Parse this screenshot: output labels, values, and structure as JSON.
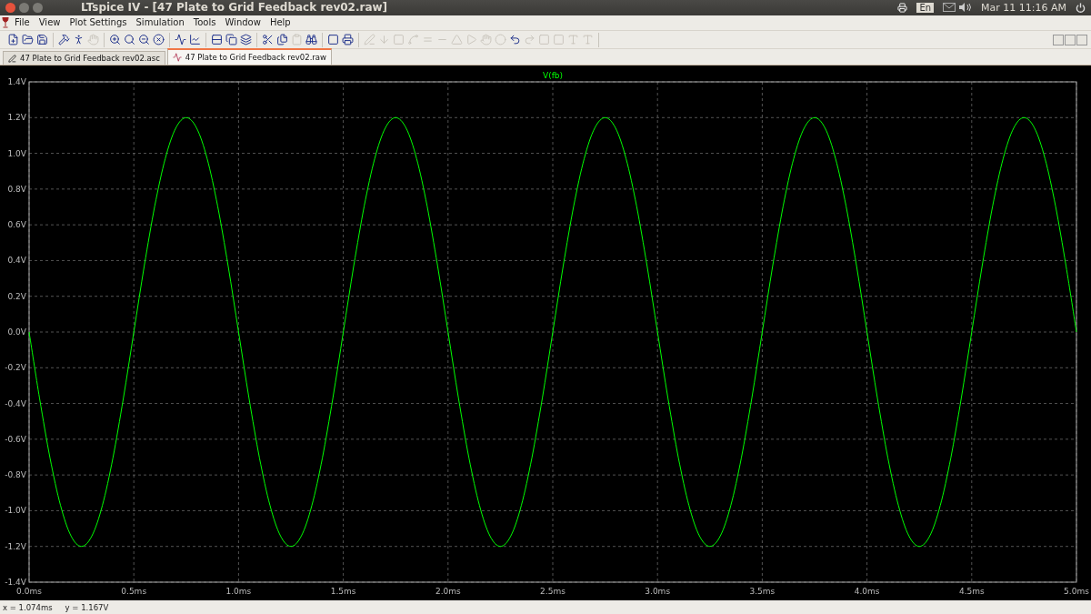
{
  "window": {
    "title": "LTspice IV - [47 Plate to Grid Feedback rev02.raw]"
  },
  "system_tray": {
    "keyboard_layout": "En",
    "clock": "Mar 11 11:16 AM"
  },
  "menu": [
    "File",
    "View",
    "Plot Settings",
    "Simulation",
    "Tools",
    "Window",
    "Help"
  ],
  "tabs": [
    {
      "label": "47 Plate to Grid Feedback rev02.asc",
      "kind": "schematic",
      "selected": false
    },
    {
      "label": "47 Plate to Grid Feedback rev02.raw",
      "kind": "waveform",
      "selected": true
    }
  ],
  "plot": {
    "chart_data": {
      "type": "line",
      "grid": true,
      "xlim": [
        0,
        5
      ],
      "ylim": [
        -1.4,
        1.4
      ],
      "xticks": [
        {
          "value": 0,
          "label": "0.0ms"
        },
        {
          "value": 0.5,
          "label": "0.5ms"
        },
        {
          "value": 1,
          "label": "1.0ms"
        },
        {
          "value": 1.5,
          "label": "1.5ms"
        },
        {
          "value": 2,
          "label": "2.0ms"
        },
        {
          "value": 2.5,
          "label": "2.5ms"
        },
        {
          "value": 3,
          "label": "3.0ms"
        },
        {
          "value": 3.5,
          "label": "3.5ms"
        },
        {
          "value": 4,
          "label": "4.0ms"
        },
        {
          "value": 4.5,
          "label": "4.5ms"
        },
        {
          "value": 5,
          "label": "5.0ms"
        }
      ],
      "yticks": [
        {
          "value": 1.4,
          "label": "1.4V"
        },
        {
          "value": 1.2,
          "label": "1.2V"
        },
        {
          "value": 1,
          "label": "1.0V"
        },
        {
          "value": 0.8,
          "label": "0.8V"
        },
        {
          "value": 0.6,
          "label": "0.6V"
        },
        {
          "value": 0.4,
          "label": "0.4V"
        },
        {
          "value": 0.2,
          "label": "0.2V"
        },
        {
          "value": 0,
          "label": "0.0V"
        },
        {
          "value": -0.2,
          "label": "-0.2V"
        },
        {
          "value": -0.4,
          "label": "-0.4V"
        },
        {
          "value": -0.6,
          "label": "-0.6V"
        },
        {
          "value": -0.8,
          "label": "-0.8V"
        },
        {
          "value": -1,
          "label": "-1.0V"
        },
        {
          "value": -1.2,
          "label": "-1.2V"
        },
        {
          "value": -1.4,
          "label": "-1.4V"
        }
      ],
      "x": [
        0,
        0.05,
        0.1,
        0.15,
        0.2,
        0.25,
        0.3,
        0.35,
        0.4,
        0.45,
        0.5,
        0.55,
        0.6,
        0.65,
        0.7,
        0.75,
        0.8,
        0.85,
        0.9,
        0.95,
        1,
        1.05,
        1.1,
        1.15,
        1.2,
        1.25,
        1.3,
        1.35,
        1.4,
        1.45,
        1.5,
        1.55,
        1.6,
        1.65,
        1.7,
        1.75,
        1.8,
        1.85,
        1.9,
        1.95,
        2,
        2.05,
        2.1,
        2.15,
        2.2,
        2.25,
        2.3,
        2.35,
        2.4,
        2.45,
        2.5,
        2.55,
        2.6,
        2.65,
        2.7,
        2.75,
        2.8,
        2.85,
        2.9,
        2.95,
        3,
        3.05,
        3.1,
        3.15,
        3.2,
        3.25,
        3.3,
        3.35,
        3.4,
        3.45,
        3.5,
        3.55,
        3.6,
        3.65,
        3.7,
        3.75,
        3.8,
        3.85,
        3.9,
        3.95,
        4,
        4.05,
        4.1,
        4.15,
        4.2,
        4.25,
        4.3,
        4.35,
        4.4,
        4.45,
        4.5,
        4.55,
        4.6,
        4.65,
        4.7,
        4.75,
        4.8,
        4.85,
        4.9,
        4.95,
        5
      ],
      "series": [
        {
          "name": "V(fb)",
          "color": "#00ff00",
          "values": [
            0,
            -0.371,
            -0.705,
            -0.971,
            -1.141,
            -1.2,
            -1.141,
            -0.971,
            -0.705,
            -0.371,
            0,
            0.371,
            0.705,
            0.971,
            1.141,
            1.2,
            1.141,
            0.971,
            0.705,
            0.371,
            0,
            -0.371,
            -0.705,
            -0.971,
            -1.141,
            -1.2,
            -1.141,
            -0.971,
            -0.705,
            -0.371,
            0,
            0.371,
            0.705,
            0.971,
            1.141,
            1.2,
            1.141,
            0.971,
            0.705,
            0.371,
            0,
            -0.371,
            -0.705,
            -0.971,
            -1.141,
            -1.2,
            -1.141,
            -0.971,
            -0.705,
            -0.371,
            0,
            0.371,
            0.705,
            0.971,
            1.141,
            1.2,
            1.141,
            0.971,
            0.705,
            0.371,
            0,
            -0.371,
            -0.705,
            -0.971,
            -1.141,
            -1.2,
            -1.141,
            -0.971,
            -0.705,
            -0.371,
            0,
            0.371,
            0.705,
            0.971,
            1.141,
            1.2,
            1.141,
            0.971,
            0.705,
            0.371,
            0,
            -0.371,
            -0.705,
            -0.971,
            -1.141,
            -1.2,
            -1.141,
            -0.971,
            -0.705,
            -0.371,
            0,
            0.371,
            0.705,
            0.971,
            1.141,
            1.2,
            1.141,
            0.971,
            0.705,
            0.371,
            0
          ]
        }
      ]
    }
  },
  "status_bar": {
    "x_reading": "x = 1.074ms",
    "y_reading": "y = 1.167V"
  }
}
